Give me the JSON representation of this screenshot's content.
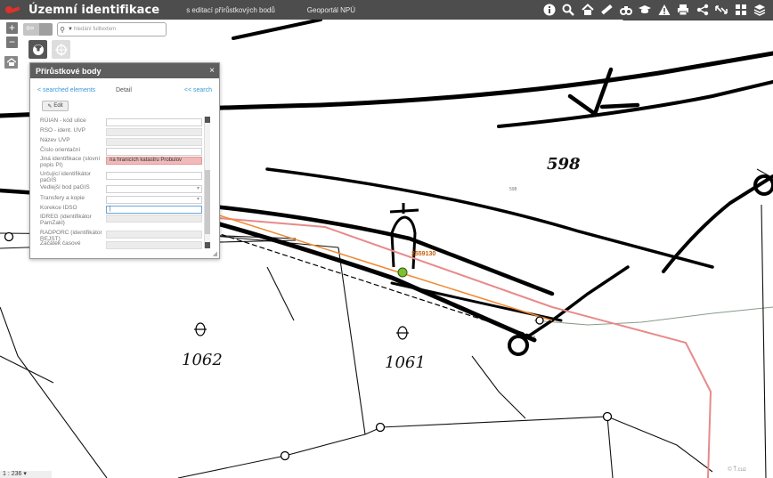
{
  "header": {
    "app_title": "Územní identifikace",
    "subtitle_link": "s editací přírůstkových bodů",
    "portal_link": "Geoportál NPÚ",
    "icons": [
      "info-icon",
      "search-icon",
      "home-icon",
      "measure-icon",
      "binoculars-icon",
      "education-icon",
      "warning-icon",
      "print-icon",
      "share-icon",
      "swap-icon",
      "grid-icon",
      "layers-icon"
    ]
  },
  "map": {
    "search": {
      "placeholder": "hledání fulltextem"
    },
    "parcel_labels": [
      "598",
      "1062",
      "1061"
    ],
    "point_label": "2559130",
    "small_label": "598",
    "scale_text": "1 : 236",
    "copyright": "© Ť.cuz",
    "colors": {
      "parcel_boundary": "#e88a8a",
      "route": "#f08a30",
      "selected_point": "#7dbf2e"
    }
  },
  "panel": {
    "title": "Přírůstkové body",
    "close": "×",
    "nav_back": "< searched elements",
    "nav_detail": "Detail",
    "nav_search": "<< search",
    "edit_label": "Edit",
    "fields": [
      {
        "label": "RÚIAN - kód ulice",
        "value": "",
        "kind": "text"
      },
      {
        "label": "RSO - ident. UVP",
        "value": "",
        "kind": "ro"
      },
      {
        "label": "Název UVP",
        "value": "",
        "kind": "ro"
      },
      {
        "label": "Číslo orientační",
        "value": "",
        "kind": "text"
      },
      {
        "label": "Jiná identifikace (slovní popis PI)",
        "value": "na hranicích katastru Probulov",
        "kind": "red"
      },
      {
        "label": "Určující identifikátor paGIS",
        "value": "",
        "kind": "text"
      },
      {
        "label": "Vedlejší bod paGIS",
        "value": "",
        "kind": "select"
      },
      {
        "label": "Transfery a kopie",
        "value": "",
        "kind": "select"
      },
      {
        "label": "Korekce IDSO",
        "value": "",
        "kind": "focus"
      },
      {
        "label": "IDREG (identifikátor PamZakl)",
        "value": "",
        "kind": "ro"
      },
      {
        "label": "RADPORC (identifikátor REJST)",
        "value": "",
        "kind": "ro"
      },
      {
        "label": "Začátek časové",
        "value": "",
        "kind": "ro"
      }
    ]
  }
}
